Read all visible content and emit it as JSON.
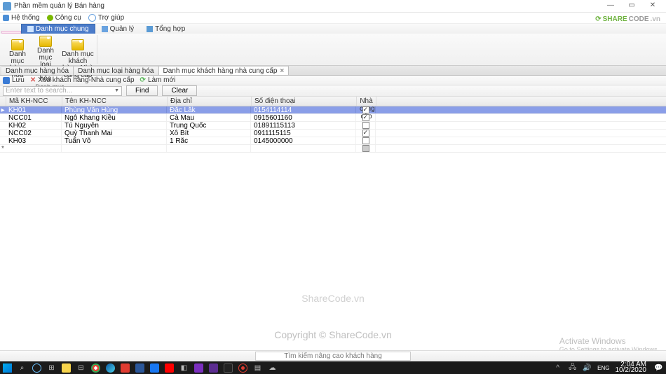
{
  "window": {
    "title": "Phần mềm quản lý Bán hàng"
  },
  "menubar": {
    "hethong": "Hệ thống",
    "congcu": "Công cụ",
    "trogiup": "Trợ giúp"
  },
  "ribbontabs": {
    "danhmucchung": "Danh mục chung",
    "quanly": "Quản lý",
    "tonghop": "Tổng hợp"
  },
  "ribbon": {
    "group_label": "Danh mục",
    "btn1": "Danh mục hàng hóa",
    "btn2": "Danh mục loại hàng hóa",
    "btn3": "Danh mục khách hàng-Nhà cung cấp"
  },
  "doctabs": {
    "t1": "Danh mục hàng hóa",
    "t2": "Danh mục loại hàng hóa",
    "t3": "Danh mục khách hàng nhà cung cấp"
  },
  "toolbar2": {
    "luu": "Lưu",
    "xoa": "Xóa khách hàng-Nhà cung cấp",
    "lammoi": "Làm mới"
  },
  "search": {
    "placeholder": "Enter text to search...",
    "find": "Find",
    "clear": "Clear"
  },
  "grid": {
    "headers": {
      "ma": "Mã KH-NCC",
      "ten": "Tên KH-NCC",
      "diachi": "Địa chỉ",
      "sdt": "Số điện thoại",
      "ncc": "Nhà cung cấp"
    },
    "rows": [
      {
        "ma": "KH01",
        "ten": "Phùng Văn Hùng",
        "diachi": "Đắc Lắk",
        "sdt": "0154114114",
        "ncc": true,
        "sel": true
      },
      {
        "ma": "NCC01",
        "ten": "Ngô Khang Kiều",
        "diachi": "Cà Mau",
        "sdt": "0915601160",
        "ncc": true
      },
      {
        "ma": "KH02",
        "ten": "Tú Nguyễn",
        "diachi": "Trung Quốc",
        "sdt": "01891115113",
        "ncc": false
      },
      {
        "ma": "NCC02",
        "ten": "Quỳ Thanh Mai",
        "diachi": "Xô Bít",
        "sdt": "0911115115",
        "ncc": true
      },
      {
        "ma": "KH03",
        "ten": "Tuấn Võ",
        "diachi": "1 Rắc",
        "sdt": "0145000000",
        "ncc": false
      }
    ]
  },
  "watermark": {
    "logo": "SHARECODE.vn",
    "center": "ShareCode.vn",
    "copyright": "Copyright © ShareCode.vn"
  },
  "activate": {
    "h": "Activate Windows",
    "s": "Go to Settings to activate Windows."
  },
  "statusbar": {
    "text": "Tìm kiếm nâng cao khách hàng"
  },
  "taskbar": {
    "lang": "ENG",
    "time": "2:04 AM",
    "date": "10/2/2020"
  }
}
